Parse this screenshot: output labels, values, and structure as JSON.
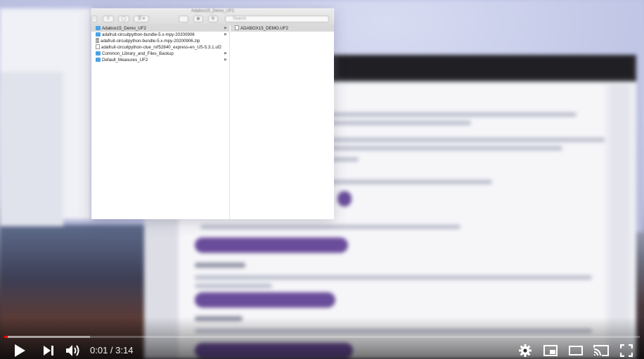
{
  "finder": {
    "title": "Adabox15_Demo_UF2",
    "search_placeholder": "Search",
    "toolbar": {
      "back": "‹",
      "share": "⇪",
      "tag": "◯",
      "view": "☰ ▾",
      "eye": "◉",
      "action": "⚙"
    },
    "column1": [
      {
        "name": "Adabox15_Demo_UF2",
        "kind": "folder",
        "selected": true,
        "has_children": true
      },
      {
        "name": "adafruit-circuitpython-bundle-5.x-mpy-20200906",
        "kind": "folder",
        "selected": false,
        "has_children": true
      },
      {
        "name": "adafruit-circuitpython-bundle-5.x-mpy-20200906.zip",
        "kind": "zip",
        "selected": false,
        "has_children": false
      },
      {
        "name": "adafruit-circuitpython-clue_nrf52840_express-en_US-5.3.1.uf2",
        "kind": "file",
        "selected": false,
        "has_children": false
      },
      {
        "name": "Common_Library_and_Files_Backup",
        "kind": "folder",
        "selected": false,
        "has_children": true
      },
      {
        "name": "Default_Measures_UF2",
        "kind": "folder",
        "selected": false,
        "has_children": true
      }
    ],
    "column2": [
      {
        "name": "ADABOX15_DEMO.UF2",
        "kind": "file",
        "selected": true
      }
    ]
  },
  "player": {
    "current_time": "0:01",
    "separator": " / ",
    "duration": "3:14",
    "played_fraction": 0.005,
    "loaded_fraction": 0.135,
    "colors": {
      "played": "#ff0000",
      "controls": "#ffffff"
    },
    "icons": [
      "play-icon",
      "next-icon",
      "volume-icon",
      "settings-icon",
      "miniplayer-icon",
      "theater-icon",
      "cast-icon",
      "fullscreen-icon"
    ]
  }
}
